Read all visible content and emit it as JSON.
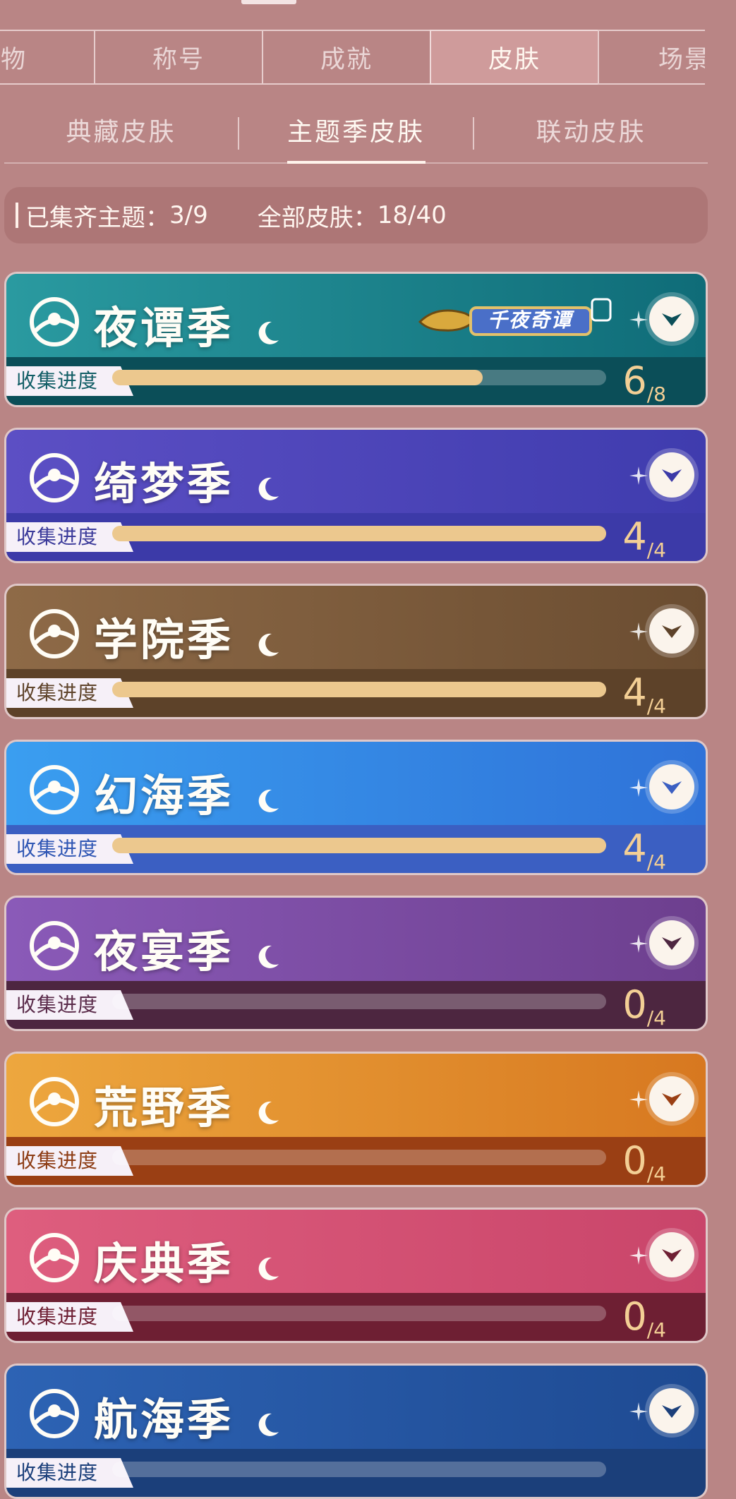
{
  "tabs": [
    {
      "label": "礼物",
      "active": false
    },
    {
      "label": "称号",
      "active": false
    },
    {
      "label": "成就",
      "active": false
    },
    {
      "label": "皮肤",
      "active": true
    },
    {
      "label": "场景",
      "active": false
    }
  ],
  "subtabs": [
    {
      "label": "典藏皮肤",
      "active": false
    },
    {
      "label": "主题季皮肤",
      "active": true
    },
    {
      "label": "联动皮肤",
      "active": false
    }
  ],
  "summary": {
    "themes_label": "已集齐主题：",
    "themes_value": "3/9",
    "skins_label": "全部皮肤：",
    "skins_value": "18/40"
  },
  "progress_label": "收集进度",
  "seasons": [
    {
      "name": "夜谭季",
      "collected": "6",
      "total": "/8",
      "progress": 0.75,
      "badge": "千夜奇谭",
      "top": "#2a9aa0",
      "top2": "#0f6c78",
      "bottom": "#0b4e58",
      "tag_text": "#125e66"
    },
    {
      "name": "绮梦季",
      "collected": "4",
      "total": "/4",
      "progress": 1.0,
      "top": "#5c4fc4",
      "top2": "#3f3cae",
      "bottom": "#3c3aa8",
      "tag_text": "#3b3a9a"
    },
    {
      "name": "学院季",
      "collected": "4",
      "total": "/4",
      "progress": 1.0,
      "top": "#8e6a47",
      "top2": "#6b4d31",
      "bottom": "#5d4229",
      "tag_text": "#5f442b"
    },
    {
      "name": "幻海季",
      "collected": "4",
      "total": "/4",
      "progress": 1.0,
      "top": "#3a9ef0",
      "top2": "#2f72d8",
      "bottom": "#3b5fc2",
      "tag_text": "#2f56b4"
    },
    {
      "name": "夜宴季",
      "collected": "0",
      "total": "/4",
      "progress": 0.0,
      "top": "#8a5ab8",
      "top2": "#6d3f8e",
      "bottom": "#4d2640",
      "tag_text": "#5a2b4a"
    },
    {
      "name": "荒野季",
      "collected": "0",
      "total": "/4",
      "progress": 0.0,
      "top": "#eda73e",
      "top2": "#d77820",
      "bottom": "#9a3f14",
      "tag_text": "#8d3c14"
    },
    {
      "name": "庆典季",
      "collected": "0",
      "total": "/4",
      "progress": 0.0,
      "top": "#de5e7e",
      "top2": "#c9456a",
      "bottom": "#6e1f33",
      "tag_text": "#6e1f33"
    },
    {
      "name": "航海季",
      "collected": "",
      "total": "",
      "progress": 0.0,
      "top": "#2d63b4",
      "top2": "#1e4a92",
      "bottom": "#1b3f7a",
      "tag_text": "#1b3f7a"
    }
  ]
}
